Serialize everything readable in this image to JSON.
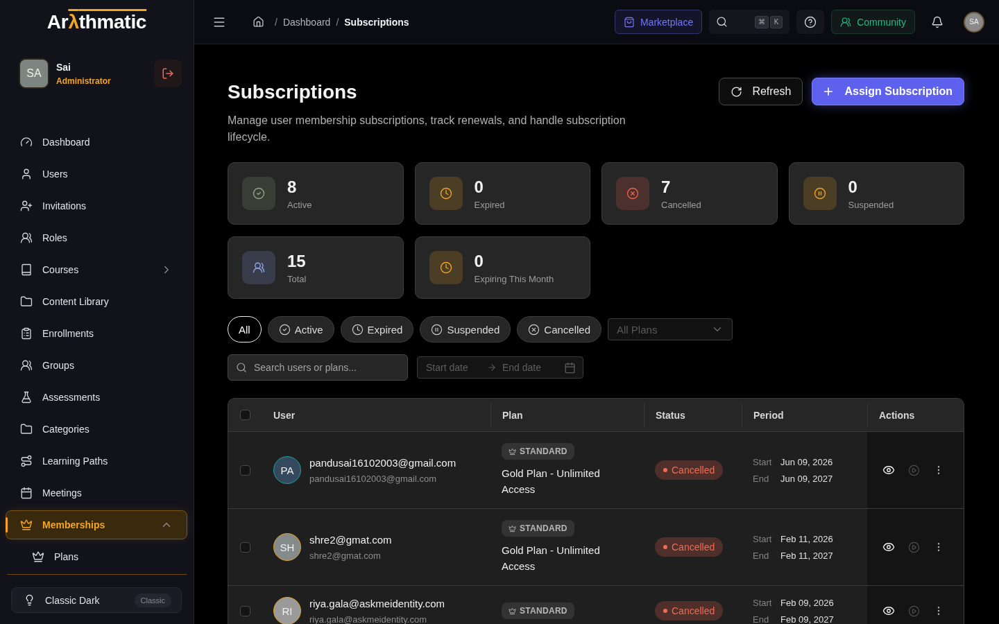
{
  "sidebar": {
    "logo": {
      "start": "Ar",
      "accent": "λ",
      "end": "thmatic"
    },
    "user": {
      "initials": "SA",
      "name": "Sai",
      "role": "Administrator"
    },
    "nav": [
      {
        "label": "Dashboard",
        "selected": false
      },
      {
        "label": "Users",
        "selected": false
      },
      {
        "label": "Invitations",
        "selected": false
      },
      {
        "label": "Roles",
        "selected": false
      },
      {
        "label": "Courses",
        "selected": false,
        "expanded": false
      },
      {
        "label": "Content Library",
        "selected": false
      },
      {
        "label": "Enrollments",
        "selected": false
      },
      {
        "label": "Groups",
        "selected": false
      },
      {
        "label": "Assessments",
        "selected": false
      },
      {
        "label": "Categories",
        "selected": false
      },
      {
        "label": "Learning Paths",
        "selected": false
      },
      {
        "label": "Meetings",
        "selected": false
      },
      {
        "label": "Memberships",
        "selected": true,
        "expanded": true,
        "children": [
          {
            "label": "Plans",
            "selected": false
          }
        ]
      }
    ],
    "theme": {
      "label": "Classic Dark",
      "badge": "Classic"
    }
  },
  "header": {
    "breadcrumbs": [
      {
        "separator": "/",
        "label": "Dashboard",
        "current": false
      },
      {
        "separator": "/",
        "label": "Subscriptions",
        "current": true
      }
    ],
    "marketplace": "Marketplace",
    "shortcut_keys": [
      "⌘",
      "K"
    ],
    "community": "Community",
    "avatar": "SA"
  },
  "page": {
    "title": "Subscriptions",
    "description": "Manage user membership subscriptions, track renewals, and handle subscription lifecycle.",
    "refresh": "Refresh",
    "assign": "Assign Subscription"
  },
  "stats": [
    {
      "value": "8",
      "label": "Active",
      "color": "#8fa77f"
    },
    {
      "value": "0",
      "label": "Expired",
      "color": "#f5a524"
    },
    {
      "value": "7",
      "label": "Cancelled",
      "color": "#f0604e"
    },
    {
      "value": "0",
      "label": "Suspended",
      "color": "#f5a524"
    },
    {
      "value": "15",
      "label": "Total",
      "color": "#8fa6ee"
    },
    {
      "value": "0",
      "label": "Expiring This Month",
      "color": "#f5a524"
    }
  ],
  "filters": {
    "chips": [
      {
        "label": "All",
        "selected": true
      },
      {
        "label": "Active",
        "selected": false
      },
      {
        "label": "Expired",
        "selected": false
      },
      {
        "label": "Suspended",
        "selected": false
      },
      {
        "label": "Cancelled",
        "selected": false
      }
    ],
    "plan_select": {
      "placeholder": "All Plans"
    },
    "search": {
      "placeholder": "Search users or plans..."
    },
    "date_range": {
      "start_placeholder": "Start date",
      "end_placeholder": "End date"
    }
  },
  "table": {
    "all_selected": false,
    "columns": [
      "User",
      "Plan",
      "Status",
      "Period",
      "Actions"
    ],
    "rows": [
      {
        "selected": false,
        "avatar": {
          "initials": "PA",
          "color": "#34495e",
          "ring": {
            "color": "#1aa59b"
          }
        },
        "name": "pandusai16102003@gmail.com",
        "email": "pandusai16102003@gmail.com",
        "plan": {
          "tier": "STANDARD",
          "name": "Gold Plan - Unlimited Access"
        },
        "status": {
          "label": "Cancelled",
          "color": "#f26b55"
        },
        "period": {
          "start_label": "Start",
          "start": "Jun 09, 2026",
          "end_label": "End",
          "end": "Jun 09, 2027"
        },
        "resume_disabled": true
      },
      {
        "selected": false,
        "avatar": {
          "initials": "SH",
          "color": "#858b8a",
          "ring": {
            "color": "#e3a21f"
          }
        },
        "name": "shre2@gmat.com",
        "email": "shre2@gmat.com",
        "plan": {
          "tier": "STANDARD",
          "name": "Gold Plan - Unlimited Access"
        },
        "status": {
          "label": "Cancelled",
          "color": "#f26b55"
        },
        "period": {
          "start_label": "Start",
          "start": "Feb 11, 2026",
          "end_label": "End",
          "end": "Feb 11, 2027"
        },
        "resume_disabled": true
      },
      {
        "selected": false,
        "avatar": {
          "initials": "RI",
          "color": "#9a9a9a",
          "ring": {
            "color": "#e3a21f"
          }
        },
        "name": "riya.gala@askmeidentity.com",
        "email": "riya.gala@askmeidentity.com",
        "plan": {
          "tier": "STANDARD"
        },
        "status": {
          "label": "Cancelled",
          "color": "#f26b55"
        },
        "period": {
          "start_label": "Start",
          "start": "Feb 09, 2026",
          "end_label": "End",
          "end": "Feb 09, 2027"
        },
        "resume_disabled": true
      }
    ]
  }
}
